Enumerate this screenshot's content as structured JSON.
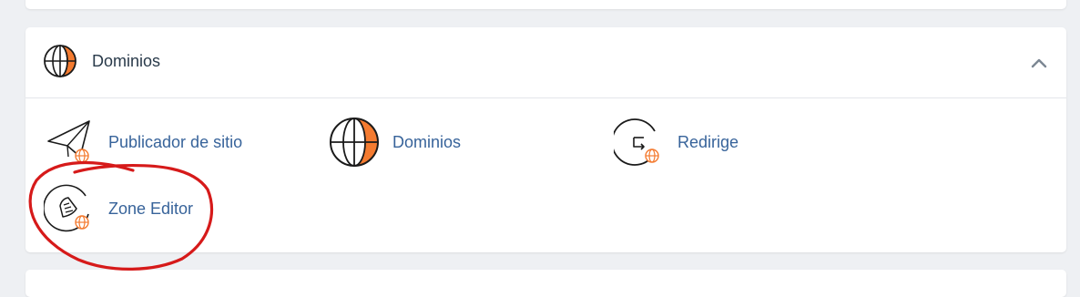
{
  "section": {
    "title": "Dominios",
    "icon": "globe-icon",
    "collapse_icon": "chevron-up-icon"
  },
  "tools": [
    {
      "label": "Publicador de sitio",
      "icon": "paper-plane-globe-icon"
    },
    {
      "label": "Dominios",
      "icon": "globe-icon"
    },
    {
      "label": "Redirige",
      "icon": "redirect-arrow-icon"
    },
    {
      "label": "Zone Editor",
      "icon": "zone-editor-rocket-icon"
    }
  ],
  "colors": {
    "accent_orange": "#f47b30",
    "link_blue": "#37639a",
    "title_dark": "#293a4a",
    "annotation_red": "#d61a1a"
  }
}
